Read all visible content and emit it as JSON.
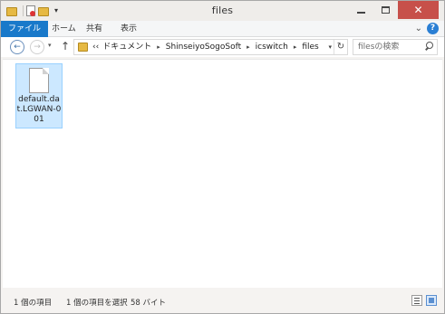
{
  "window": {
    "title": "files"
  },
  "quick_access": {
    "icons": [
      "folder-icon",
      "properties-icon",
      "new-folder-icon",
      "dropdown-icon"
    ]
  },
  "ribbon": {
    "tabs": [
      {
        "label": "ファイル",
        "active": true
      },
      {
        "label": "ホーム",
        "active": false
      },
      {
        "label": "共有",
        "active": false
      },
      {
        "label": "表示",
        "active": false
      }
    ],
    "help_label": "?"
  },
  "address": {
    "overflow": "‹‹",
    "crumbs": [
      "ドキュメント",
      "ShinseiyoSogoSoft",
      "icswitch",
      "files"
    ],
    "separator": "▸"
  },
  "search": {
    "placeholder": "filesの検索"
  },
  "files": [
    {
      "name": "default.dat.LGWAN-001",
      "selected": true
    }
  ],
  "status": {
    "item_count": "1 個の項目",
    "selection": "1 個の項目を選択",
    "size": "58 バイト"
  },
  "colors": {
    "accent": "#1979ca",
    "selection_bg": "#cce8ff",
    "close_button": "#c7504a"
  }
}
